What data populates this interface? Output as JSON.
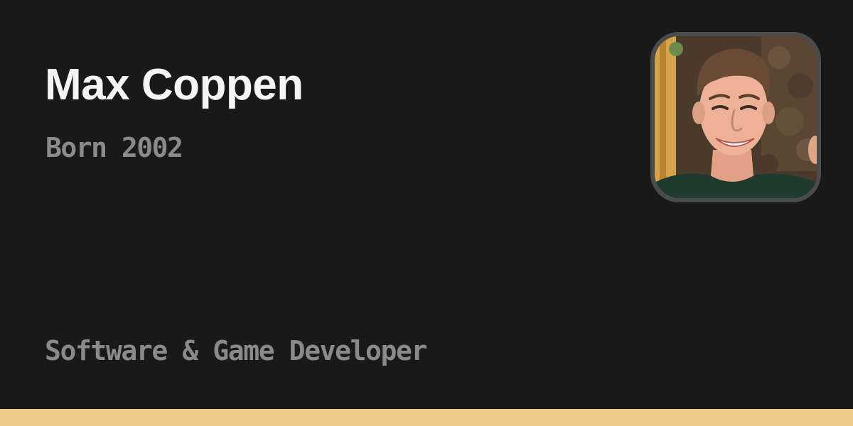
{
  "profile": {
    "name": "Max Coppen",
    "born": "Born 2002",
    "role": "Software & Game Developer"
  },
  "avatar": {
    "icon": "portrait-photo-icon"
  },
  "colors": {
    "background": "#191919",
    "name_text": "#f4f4f4",
    "muted_text": "#8a8a8a",
    "avatar_border": "#4b4b4b",
    "accent_bar": "#ebc987"
  }
}
